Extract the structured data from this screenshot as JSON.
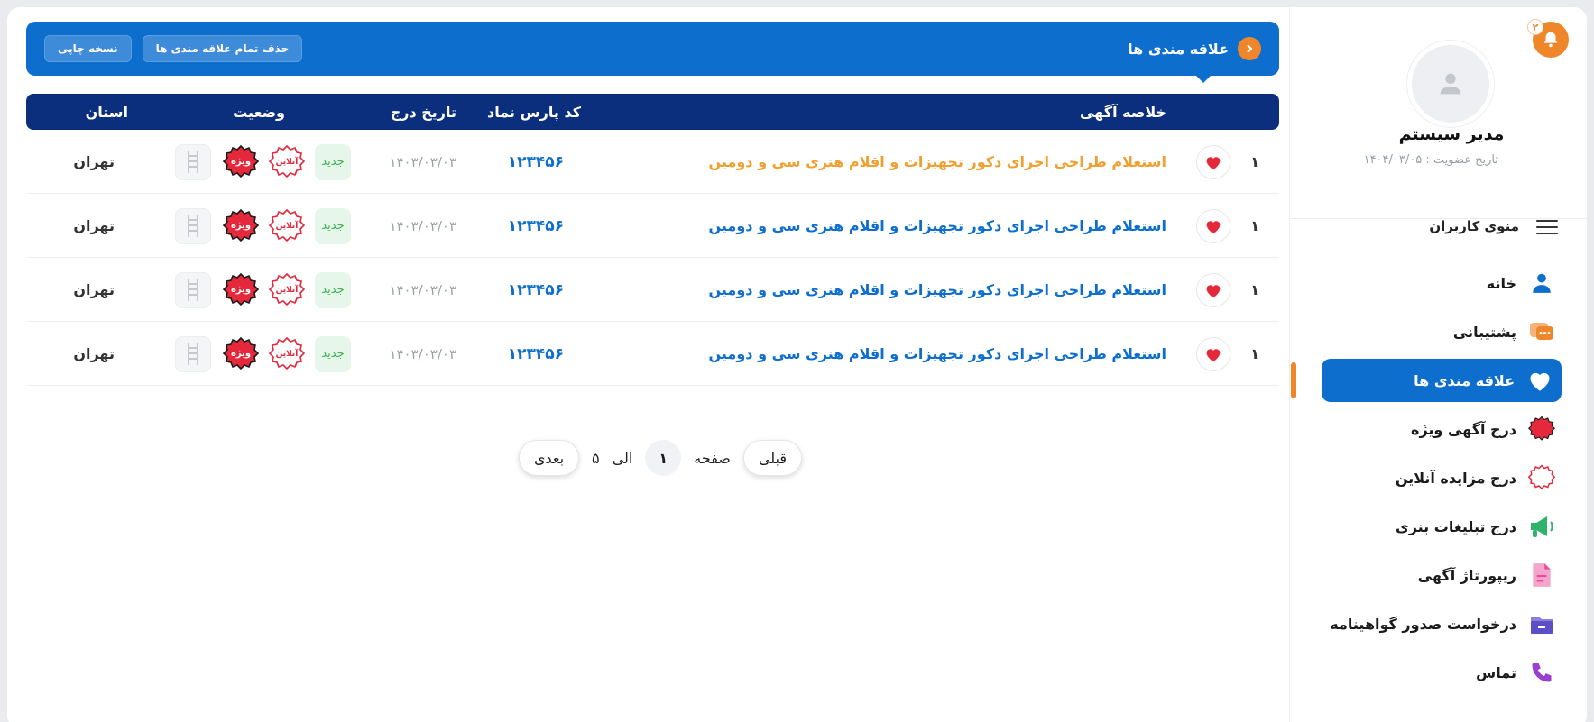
{
  "sidebar": {
    "notification_count": "۲",
    "user_name": "مدیر سیستم",
    "member_since_label": "تاریخ عضویت : ۱۴۰۴/۰۳/۰۵",
    "menu_title": "منوی کاربران",
    "items": [
      {
        "label": "خانه",
        "icon": "user-icon",
        "color": "#0d6ecd"
      },
      {
        "label": "پشتیبانی",
        "icon": "chat-icon",
        "color": "#f0862a"
      },
      {
        "label": "علاقه مندی ها",
        "icon": "heart-icon",
        "color": "#ffffff"
      },
      {
        "label": "درج آگهی ویژه",
        "icon": "special-seal-icon",
        "color": "#e5283c"
      },
      {
        "label": "درج مزایده آنلاین",
        "icon": "online-seal-icon",
        "color": "#e5283c"
      },
      {
        "label": "درج تبلیغات بنری",
        "icon": "megaphone-icon",
        "color": "#2fb36a"
      },
      {
        "label": "ریپورتاژ آگهی",
        "icon": "document-icon",
        "color": "#e84b9c"
      },
      {
        "label": "درخواست صدور گواهینامه",
        "icon": "folder-icon",
        "color": "#5b4fc8"
      },
      {
        "label": "تماس",
        "icon": "phone-icon",
        "color": "#9b3fd1"
      }
    ]
  },
  "header": {
    "title": "علاقه مندی ها",
    "delete_all_label": "حذف تمام علاقه مندی ها",
    "print_label": "نسخه چاپی"
  },
  "table": {
    "columns": {
      "summary": "خلاصه آگهی",
      "code": "کد پارس نماد",
      "date": "تاریخ درج",
      "status": "وضعیت",
      "province": "استان"
    },
    "rows": [
      {
        "index": "۱",
        "summary": "استعلام طراحی اجرای دکور تجهیزات و اقلام هنری سی و دومین",
        "code": "۱۲۳۴۵۶",
        "date": "۱۴۰۳/۰۳/۰۳",
        "new": "جدید",
        "online": "آنلاین",
        "special": "ویژه",
        "province": "تهران",
        "highlight": true
      },
      {
        "index": "۱",
        "summary": "استعلام طراحی اجرای دکور تجهیزات و اقلام هنری سی و دومین",
        "code": "۱۲۳۴۵۶",
        "date": "۱۴۰۳/۰۳/۰۳",
        "new": "جدید",
        "online": "آنلاین",
        "special": "ویژه",
        "province": "تهران",
        "highlight": false
      },
      {
        "index": "۱",
        "summary": "استعلام طراحی اجرای دکور تجهیزات و اقلام هنری سی و دومین",
        "code": "۱۲۳۴۵۶",
        "date": "۱۴۰۳/۰۳/۰۳",
        "new": "جدید",
        "online": "آنلاین",
        "special": "ویژه",
        "province": "تهران",
        "highlight": false
      },
      {
        "index": "۱",
        "summary": "استعلام طراحی اجرای دکور تجهیزات و اقلام هنری سی و دومین",
        "code": "۱۲۳۴۵۶",
        "date": "۱۴۰۳/۰۳/۰۳",
        "new": "جدید",
        "online": "آنلاین",
        "special": "ویژه",
        "province": "تهران",
        "highlight": false
      }
    ]
  },
  "pagination": {
    "prev_label": "قبلی",
    "page_word": "صفحه",
    "current_page": "۱",
    "of_word": "الی",
    "total_pages": "۵",
    "next_label": "بعدی"
  },
  "colors": {
    "primary": "#0d6ecd",
    "navy": "#0b2f7c",
    "accent": "#f0862a",
    "danger": "#e5283c",
    "success": "#3cb155"
  }
}
